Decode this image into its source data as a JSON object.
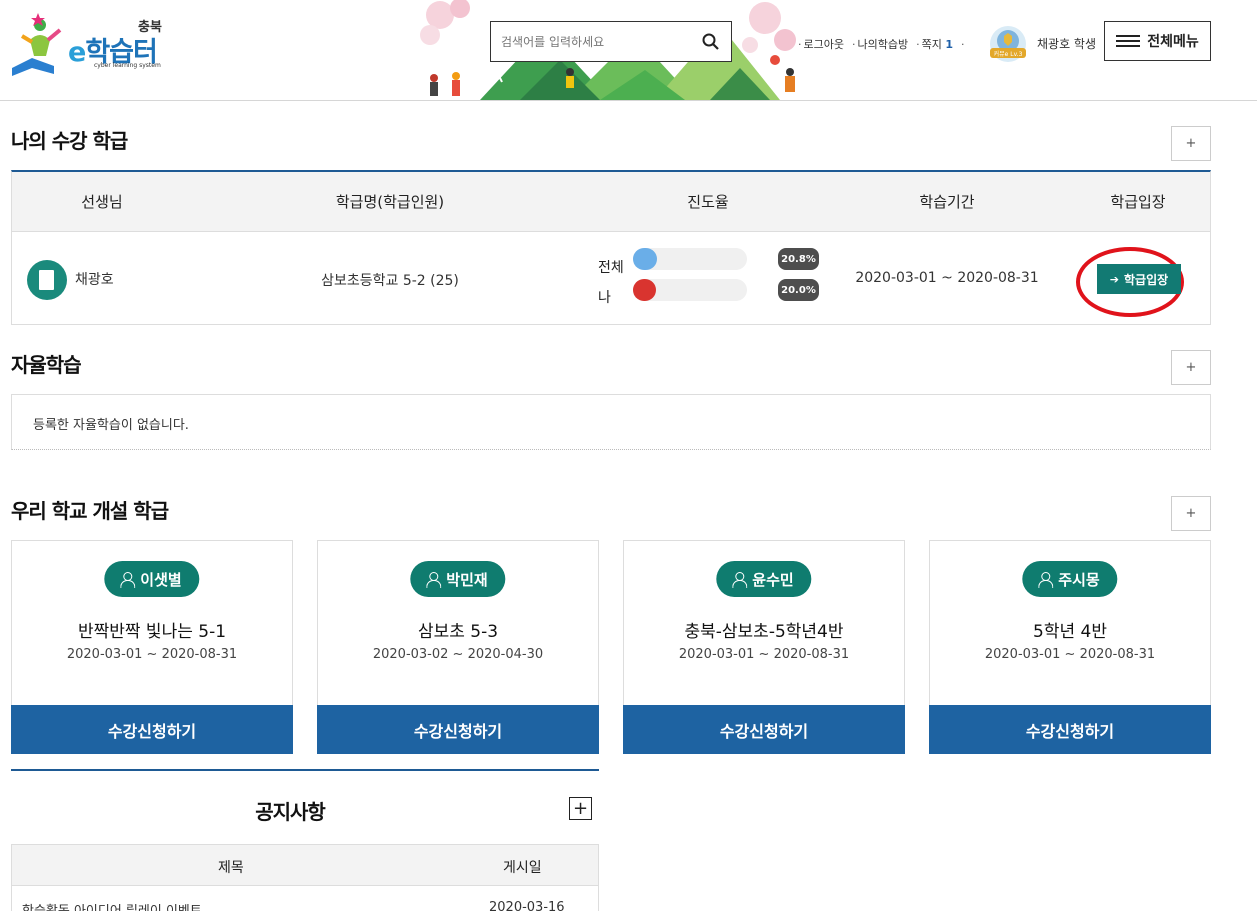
{
  "header": {
    "logo": {
      "region": "충북",
      "name_e": "e",
      "name_rest": "학습터",
      "tagline": "cyber learning system"
    },
    "search": {
      "placeholder": "검색어를 입력하세요"
    },
    "nav": {
      "logout": "로그아웃",
      "my_room": "나의학습방",
      "messages": "쪽지",
      "message_count": "1"
    },
    "level_badge": "커뮤e Lv.3",
    "user": "채광호 학생",
    "menu_label": "전체메뉴"
  },
  "my_classes": {
    "title": "나의 수강 학급",
    "plus": "+",
    "columns": [
      "선생님",
      "학급명(학급인원)",
      "진도율",
      "학습기간",
      "학급입장"
    ],
    "rows": [
      {
        "teacher": "채광호",
        "class_name": "삼보초등학교 5-2 (25)",
        "progress_total_label": "전체",
        "progress_total": "20.8%",
        "progress_total_value": 0.208,
        "progress_me_label": "나",
        "progress_me": "20.0%",
        "progress_me_value": 0.2,
        "period": "2020-03-01 ~ 2020-08-31",
        "enter_label": "학급입장"
      }
    ],
    "colors": {
      "total_progress": "#6aaee8",
      "my_progress": "#d9342f",
      "enter_button": "#127a73",
      "highlight_ring": "#e0131b"
    }
  },
  "self_study": {
    "title": "자율학습",
    "plus": "+",
    "empty_text": "등록한 자율학습이 없습니다."
  },
  "school_classes": {
    "title": "우리 학교 개설 학급",
    "plus": "+",
    "cards": [
      {
        "teacher": "이샛별",
        "title": "반짝반짝 빛나는 5-1",
        "period": "2020-03-01 ~ 2020-08-31",
        "apply_label": "수강신청하기"
      },
      {
        "teacher": "박민재",
        "title": "삼보초 5-3",
        "period": "2020-03-02 ~ 2020-04-30",
        "apply_label": "수강신청하기"
      },
      {
        "teacher": "윤수민",
        "title": "충북-삼보초-5학년4반",
        "period": "2020-03-01 ~ 2020-08-31",
        "apply_label": "수강신청하기"
      },
      {
        "teacher": "주시몽",
        "title": "5학년 4반",
        "period": "2020-03-01 ~ 2020-08-31",
        "apply_label": "수강신청하기"
      }
    ]
  },
  "notice": {
    "title": "공지사항",
    "plus": "+",
    "columns": [
      "제목",
      "게시일"
    ],
    "rows": [
      {
        "title": "학습활동 아이디어 릴레이 이벤트",
        "date": "2020-03-16"
      }
    ]
  }
}
